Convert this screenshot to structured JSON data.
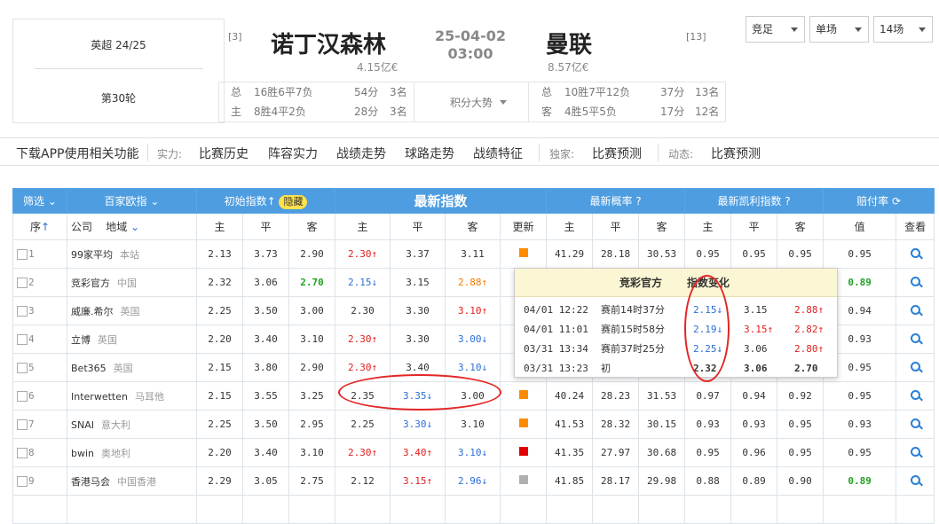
{
  "league": {
    "name": "英超 24/25",
    "round": "第30轮"
  },
  "match": {
    "date": "25-04-02",
    "time": "03:00",
    "home": {
      "rank": "[3]",
      "name": "诺丁汉森林",
      "value": "4.15亿€"
    },
    "away": {
      "rank": "[13]",
      "name": "曼联",
      "value": "8.57亿€"
    }
  },
  "records": {
    "center": "积分大势",
    "home": [
      {
        "label": "总",
        "wdl": "16胜6平7负",
        "pts": "54分",
        "pos": "3名"
      },
      {
        "label": "主",
        "wdl": "8胜4平2负",
        "pts": "28分",
        "pos": "3名"
      }
    ],
    "away": [
      {
        "label": "总",
        "wdl": "10胜7平12负",
        "pts": "37分",
        "pos": "13名"
      },
      {
        "label": "客",
        "wdl": "4胜5平5负",
        "pts": "17分",
        "pos": "12名"
      }
    ]
  },
  "selects": [
    "竞足",
    "单场",
    "14场"
  ],
  "nav": {
    "download": "下载APP使用相关功能",
    "g1": "实力:",
    "items1": [
      "比赛历史",
      "阵容实力",
      "战绩走势",
      "球路走势",
      "战绩特征"
    ],
    "g2": "独家:",
    "items2": [
      "比赛预测"
    ],
    "g3": "动态:",
    "items3": [
      "比赛预测"
    ]
  },
  "table": {
    "h1": {
      "filter": "筛选",
      "europe": "百家欧指",
      "initial": "初始指数",
      "hide": "隐藏",
      "latest": "最新指数",
      "prob": "最新概率",
      "kelly": "最新凯利指数",
      "payout": "赔付率"
    },
    "h2": {
      "seq": "序",
      "company": "公司",
      "region": "地域",
      "home": "主",
      "draw": "平",
      "away": "客",
      "update": "更新",
      "value": "值",
      "view": "查看"
    },
    "rows": [
      {
        "i": "1",
        "c": "99家平均",
        "r": "本站",
        "init": [
          "2.13",
          "3.73",
          "2.90"
        ],
        "ia": "",
        "lat": [
          "2.30↑",
          "3.37",
          "3.11"
        ],
        "lc": [
          "red",
          "",
          ""
        ],
        "upd": "#ff8c00",
        "prob": [
          "41.29",
          "28.18",
          "30.53"
        ],
        "kel": [
          "0.95",
          "0.95",
          "0.95"
        ],
        "kc": [
          "",
          "",
          ""
        ],
        "pay": "0.95",
        "pc": ""
      },
      {
        "i": "2",
        "c": "竞彩官方",
        "r": "中国",
        "init": [
          "2.32",
          "3.06",
          "2.70"
        ],
        "ia": "grn",
        "lat": [
          "2.15↓",
          "3.15",
          "2.88↑"
        ],
        "lc": [
          "blue",
          "",
          "org"
        ],
        "upd": "",
        "prob": [
          "",
          "",
          ""
        ],
        "kel": [
          "",
          "",
          ""
        ],
        "kc": [
          "",
          "",
          ""
        ],
        "pay": "0.89",
        "pc": "grn"
      },
      {
        "i": "3",
        "c": "威廉.希尔",
        "r": "英国",
        "init": [
          "2.25",
          "3.50",
          "3.00"
        ],
        "ia": "",
        "lat": [
          "2.30",
          "3.30",
          "3.10↑"
        ],
        "lc": [
          "",
          "",
          "red"
        ],
        "upd": "",
        "prob": [
          "",
          "",
          ""
        ],
        "kel": [
          "",
          "",
          ""
        ],
        "kc": [
          "",
          "",
          ""
        ],
        "pay": "0.94",
        "pc": ""
      },
      {
        "i": "4",
        "c": "立博",
        "r": "英国",
        "init": [
          "2.20",
          "3.40",
          "3.10"
        ],
        "ia": "",
        "lat": [
          "2.30↑",
          "3.30",
          "3.00↓"
        ],
        "lc": [
          "red",
          "",
          "blue"
        ],
        "upd": "",
        "prob": [
          "",
          "",
          ""
        ],
        "kel": [
          "",
          "",
          ""
        ],
        "kc": [
          "",
          "",
          ""
        ],
        "pay": "0.93",
        "pc": ""
      },
      {
        "i": "5",
        "c": "Bet365",
        "r": "英国",
        "init": [
          "2.15",
          "3.80",
          "2.90"
        ],
        "ia": "",
        "lat": [
          "2.30↑",
          "3.40",
          "3.10↓"
        ],
        "lc": [
          "red",
          "",
          "blue"
        ],
        "upd": "",
        "prob": [
          "",
          "",
          ""
        ],
        "kel": [
          "",
          "",
          ""
        ],
        "kc": [
          "",
          "",
          ""
        ],
        "pay": "0.95",
        "pc": ""
      },
      {
        "i": "6",
        "c": "Interwetten",
        "r": "马耳他",
        "init": [
          "2.15",
          "3.55",
          "3.25"
        ],
        "ia": "",
        "lat": [
          "2.35",
          "3.35↓",
          "3.00"
        ],
        "lc": [
          "",
          "blue",
          ""
        ],
        "upd": "#ff8c00",
        "prob": [
          "40.24",
          "28.23",
          "31.53"
        ],
        "kel": [
          "0.97",
          "0.94",
          "0.92"
        ],
        "kc": [
          "",
          "",
          ""
        ],
        "pay": "0.95",
        "pc": ""
      },
      {
        "i": "7",
        "c": "SNAI",
        "r": "意大利",
        "init": [
          "2.25",
          "3.50",
          "2.95"
        ],
        "ia": "",
        "lat": [
          "2.25",
          "3.30↓",
          "3.10"
        ],
        "lc": [
          "",
          "blue",
          ""
        ],
        "upd": "#ff8c00",
        "prob": [
          "41.53",
          "28.32",
          "30.15"
        ],
        "kel": [
          "0.93",
          "0.93",
          "0.95"
        ],
        "kc": [
          "",
          "",
          ""
        ],
        "pay": "0.93",
        "pc": ""
      },
      {
        "i": "8",
        "c": "bwin",
        "r": "奥地利",
        "init": [
          "2.20",
          "3.40",
          "3.10"
        ],
        "ia": "",
        "lat": [
          "2.30↑",
          "3.40↑",
          "3.10↓"
        ],
        "lc": [
          "red",
          "red",
          "blue"
        ],
        "upd": "#e00000",
        "prob": [
          "41.35",
          "27.97",
          "30.68"
        ],
        "kel": [
          "0.95",
          "0.96",
          "0.95"
        ],
        "kc": [
          "",
          "",
          ""
        ],
        "pay": "0.95",
        "pc": ""
      },
      {
        "i": "9",
        "c": "香港马会",
        "r": "中国香港",
        "init": [
          "2.29",
          "3.05",
          "2.75"
        ],
        "ia": "",
        "lat": [
          "2.12",
          "3.15↑",
          "2.96↓"
        ],
        "lc": [
          "",
          "red",
          "blue"
        ],
        "upd": "#b0b0b0",
        "prob": [
          "41.85",
          "28.17",
          "29.98"
        ],
        "kel": [
          "0.88",
          "0.89",
          "0.90"
        ],
        "kc": [
          "",
          "",
          ""
        ],
        "pay": "0.89",
        "pc": "grn"
      }
    ]
  },
  "popup": {
    "title": "竞彩官方",
    "subtitle": "指数变化",
    "rows": [
      {
        "d": "04/01 12:22",
        "t": "赛前14时37分",
        "h": "2.15↓",
        "hc": "blue",
        "dr": "3.15",
        "dc": "",
        "a": "2.88↑",
        "ac": "red"
      },
      {
        "d": "04/01 11:01",
        "t": "赛前15时58分",
        "h": "2.19↓",
        "hc": "blue",
        "dr": "3.15↑",
        "dc": "red",
        "a": "2.82↑",
        "ac": "red"
      },
      {
        "d": "03/31 13:34",
        "t": "赛前37时25分",
        "h": "2.25↓",
        "hc": "blue",
        "dr": "3.06",
        "dc": "",
        "a": "2.80↑",
        "ac": "red"
      },
      {
        "d": "03/31 13:23",
        "t": "初",
        "h": "2.32",
        "hc": "",
        "dr": "3.06",
        "dc": "",
        "a": "2.70",
        "ac": ""
      }
    ]
  }
}
